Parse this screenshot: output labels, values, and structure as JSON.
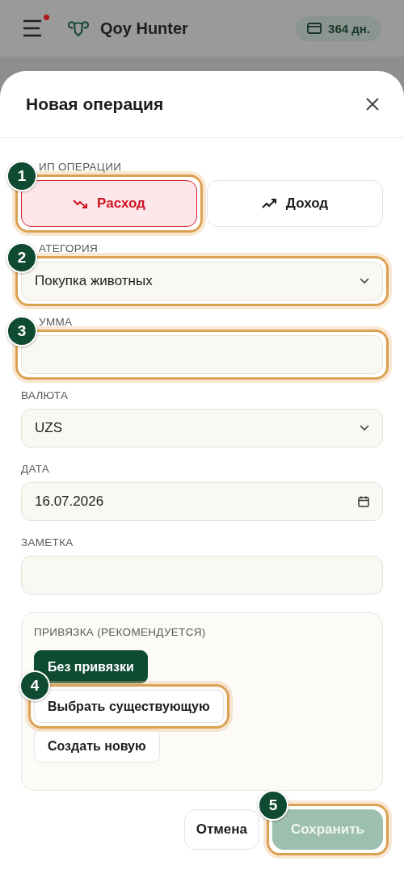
{
  "header": {
    "title": "Qoy Hunter",
    "notification": true,
    "days": "364 дн."
  },
  "sheet": {
    "title": "Новая операция",
    "type_field": {
      "label": "ИП ОПЕРАЦИИ",
      "options": [
        {
          "label": "Расход",
          "kind": "expense",
          "selected": true,
          "step": "1"
        },
        {
          "label": "Доход",
          "kind": "income",
          "selected": false
        }
      ]
    },
    "fields": [
      {
        "label": "АТЕГОРИЯ",
        "kind": "select",
        "value": "Покупка животных",
        "step": "2"
      },
      {
        "label": "УММА",
        "kind": "text",
        "step": "3"
      },
      {
        "label": "ВАЛЮТА",
        "kind": "select",
        "value": "UZS"
      },
      {
        "label": "ДАТА",
        "kind": "date",
        "value": "16.07.2026"
      },
      {
        "label": "ЗАМЕТКА",
        "kind": "text"
      }
    ],
    "link": {
      "label": "ПРИВЯЗКА (РЕКОМЕНДУЕТСЯ)",
      "options": [
        {
          "label": "Без привязки",
          "selected": true
        },
        {
          "label": "Выбрать существующую",
          "selected": false,
          "step": "4"
        },
        {
          "label": "Создать новую",
          "selected": false
        }
      ]
    },
    "actions": [
      {
        "label": "Отмена",
        "kind": "cancel"
      },
      {
        "label": "Сохранить",
        "kind": "primary",
        "disabled": true,
        "step": "5"
      }
    ]
  }
}
